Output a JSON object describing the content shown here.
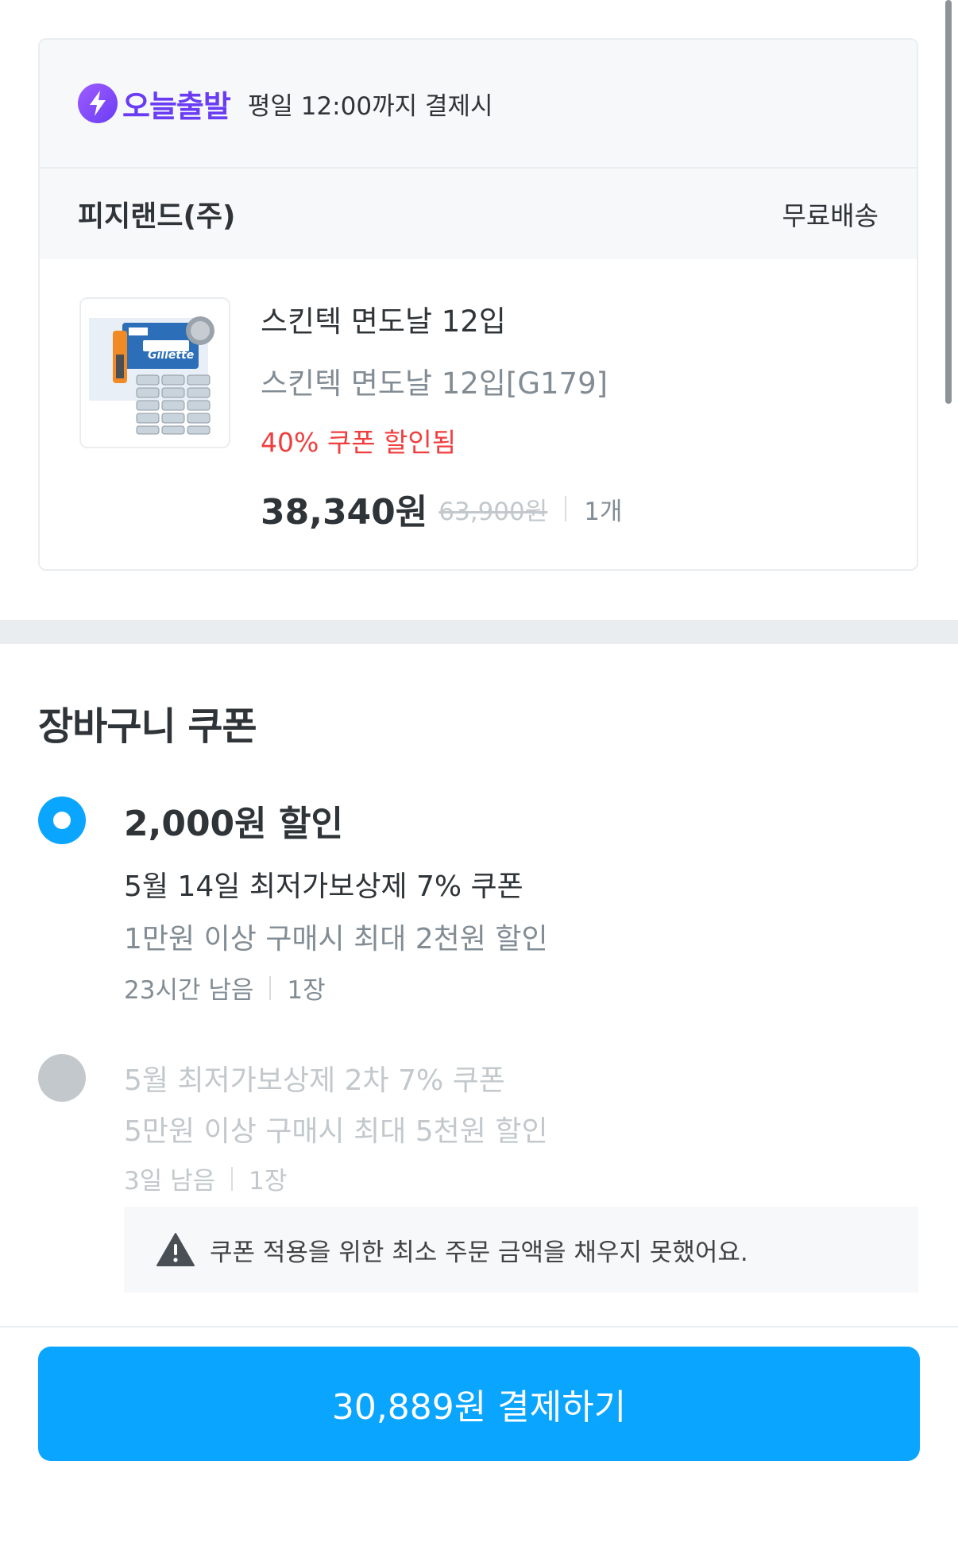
{
  "order": {
    "delivery_badge": "오늘출발",
    "delivery_note": "평일 12:00까지 결제시",
    "seller": "피지랜드(주)",
    "shipping": "무료배송",
    "product": {
      "title": "스킨텍 면도날 12입",
      "option": "스킨텍 면도날 12입[G179]",
      "coupon_note": "40% 쿠폰 할인됨",
      "price": "38,340원",
      "original_price": "63,900원",
      "quantity": "1개",
      "thumbnail_brand": "Gillette"
    }
  },
  "coupons": {
    "heading": "장바구니 쿠폰",
    "items": [
      {
        "amount": "2,000원 할인",
        "name": "5월 14일 최저가보상제 7% 쿠폰",
        "condition": "1만원 이상 구매시 최대 2천원 할인",
        "remaining": "23시간 남음",
        "count": "1장"
      },
      {
        "name": "5월 최저가보상제 2차 7% 쿠폰",
        "condition": "5만원 이상 구매시 최대 5천원 할인",
        "remaining": "3일 남음",
        "count": "1장",
        "warning": "쿠폰 적용을 위한 최소 주문 금액을 채우지 못했어요."
      }
    ]
  },
  "pay_button": "30,889원 결제하기",
  "colors": {
    "accent": "#0aa5ff",
    "today_purple": "#6a3df5",
    "discount_red": "#f03e3e"
  }
}
